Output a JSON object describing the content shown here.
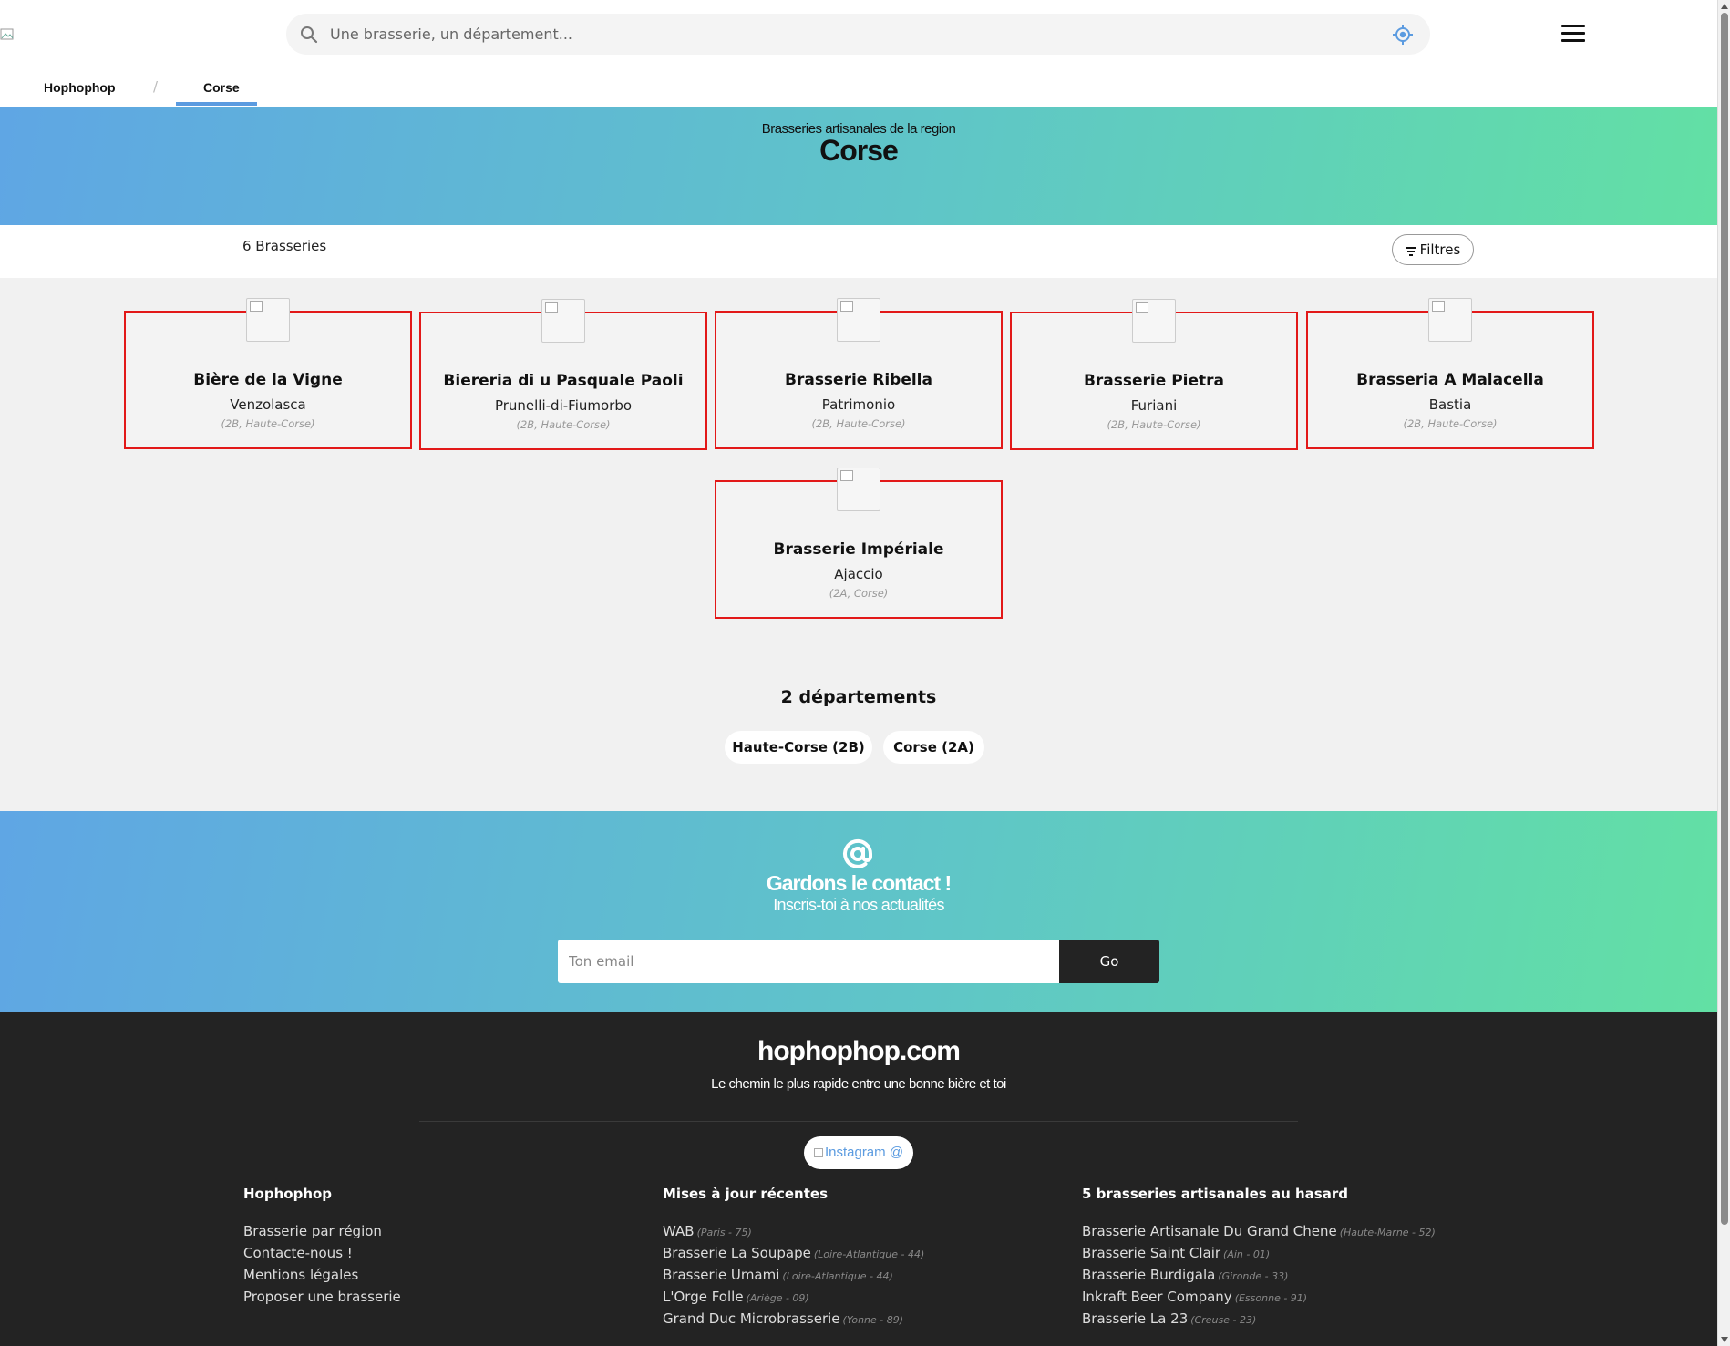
{
  "header": {
    "search_placeholder": "Une brasserie, un département...",
    "icons": {
      "search": "search-icon",
      "locate": "crosshair-icon",
      "menu": "hamburger-icon",
      "logo": "broken-image-icon"
    }
  },
  "breadcrumb": {
    "items": [
      {
        "label": "Hophophop"
      },
      {
        "label": "Corse",
        "active": true
      }
    ],
    "separator": "/"
  },
  "hero": {
    "subtitle": "Brasseries artisanales de la region",
    "title": "Corse"
  },
  "results": {
    "count_label": "6 Brasseries",
    "filters_label": "Filtres"
  },
  "breweries": [
    {
      "name": "Bière de la Vigne",
      "city": "Venzolasca",
      "dept": "(2B, Haute-Corse)"
    },
    {
      "name": "Biereria di u Pasquale Paoli",
      "city": "Prunelli-di-Fiumorbo",
      "dept": "(2B, Haute-Corse)"
    },
    {
      "name": "Brasserie Ribella",
      "city": "Patrimonio",
      "dept": "(2B, Haute-Corse)"
    },
    {
      "name": "Brasserie Pietra",
      "city": "Furiani",
      "dept": "(2B, Haute-Corse)"
    },
    {
      "name": "Brasseria A Malacella",
      "city": "Bastia",
      "dept": "(2B, Haute-Corse)"
    },
    {
      "name": "Brasserie Impériale",
      "city": "Ajaccio",
      "dept": "(2A, Corse)"
    }
  ],
  "departements": {
    "title": "2 départements",
    "items": [
      {
        "label": "Haute-Corse (2B)"
      },
      {
        "label": "Corse (2A)"
      }
    ]
  },
  "newsletter": {
    "title": "Gardons le contact !",
    "subtitle": "Inscris-toi à nos actualités",
    "email_placeholder": "Ton email",
    "go_label": "Go"
  },
  "footer": {
    "brand": "hophophop.com",
    "tagline": "Le chemin le plus rapide entre une bonne bière et toi",
    "instagram_label": "Instagram @",
    "col1": {
      "title": "Hophophop",
      "links": [
        "Brasserie par région",
        "Contacte-nous !",
        "Mentions légales",
        "Proposer une brasserie"
      ]
    },
    "col2": {
      "title": "Mises à jour récentes",
      "links": [
        {
          "name": "WAB",
          "meta": "(Paris - 75)"
        },
        {
          "name": "Brasserie La Soupape",
          "meta": "(Loire-Atlantique - 44)"
        },
        {
          "name": "Brasserie Umami",
          "meta": "(Loire-Atlantique - 44)"
        },
        {
          "name": "L'Orge Folle",
          "meta": "(Ariège - 09)"
        },
        {
          "name": "Grand Duc Microbrasserie",
          "meta": "(Yonne - 89)"
        }
      ]
    },
    "col3": {
      "title": "5 brasseries artisanales au hasard",
      "links": [
        {
          "name": "Brasserie Artisanale Du Grand Chene",
          "meta": "(Haute-Marne - 52)"
        },
        {
          "name": "Brasserie Saint Clair",
          "meta": "(Ain - 01)"
        },
        {
          "name": "Brasserie Burdigala",
          "meta": "(Gironde - 33)"
        },
        {
          "name": "Inkraft Beer Company",
          "meta": "(Essonne - 91)"
        },
        {
          "name": "Brasserie La 23",
          "meta": "(Creuse - 23)"
        }
      ]
    }
  },
  "colors": {
    "gradient_start": "#5fa6e4",
    "gradient_end": "#62e0a4",
    "card_border": "#e21818",
    "footer_bg": "#232323",
    "accent": "#5b9be0"
  }
}
